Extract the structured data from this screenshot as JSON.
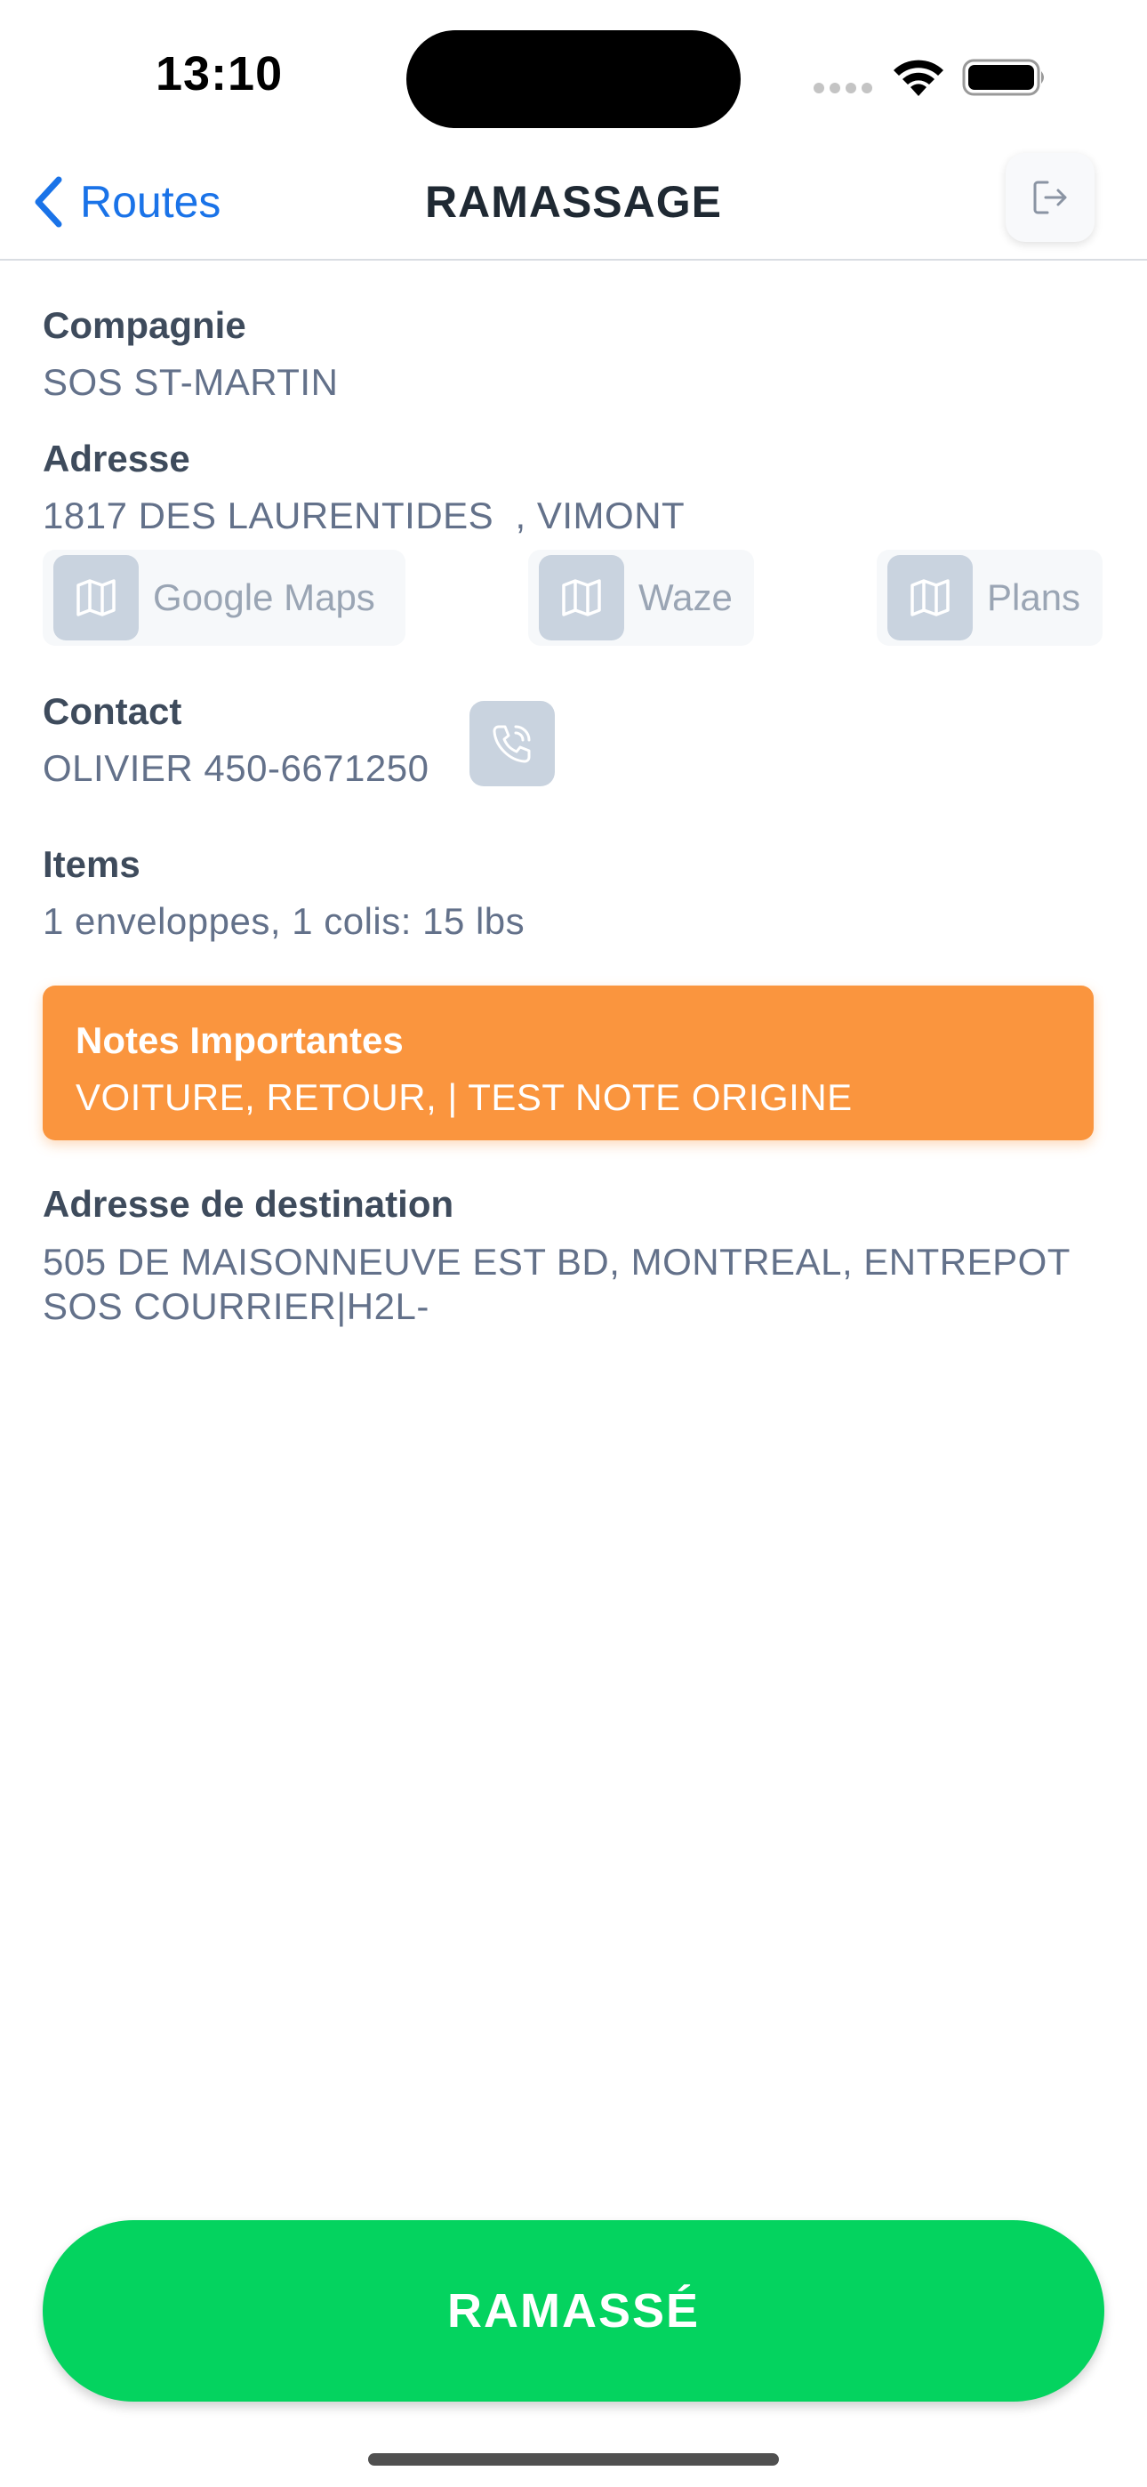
{
  "status_bar": {
    "time": "13:10"
  },
  "nav": {
    "back_label": "Routes",
    "title": "RAMASSAGE"
  },
  "company": {
    "label": "Compagnie",
    "value": "SOS ST-MARTIN"
  },
  "address": {
    "label": "Adresse",
    "value": "1817 DES LAURENTIDES  , VIMONT",
    "map_buttons": [
      "Google Maps",
      "Waze",
      "Plans"
    ]
  },
  "contact": {
    "label": "Contact",
    "value": "OLIVIER 450-6671250"
  },
  "items": {
    "label": "Items",
    "value": "1 enveloppes, 1 colis: 15 lbs"
  },
  "notes": {
    "title": "Notes Importantes",
    "text": "VOITURE, RETOUR, | TEST NOTE ORIGINE"
  },
  "destination": {
    "label": "Adresse de destination",
    "value_line1": "505 DE MAISONNEUVE EST BD, MONTREAL, ENTREPOT",
    "value_line2": "SOS COURRIER|H2L-"
  },
  "primary_action": {
    "label": "RAMASSÉ"
  },
  "colors": {
    "accent_blue": "#1a73e8",
    "notes_orange": "#fa953e",
    "action_green": "#04d35f"
  }
}
